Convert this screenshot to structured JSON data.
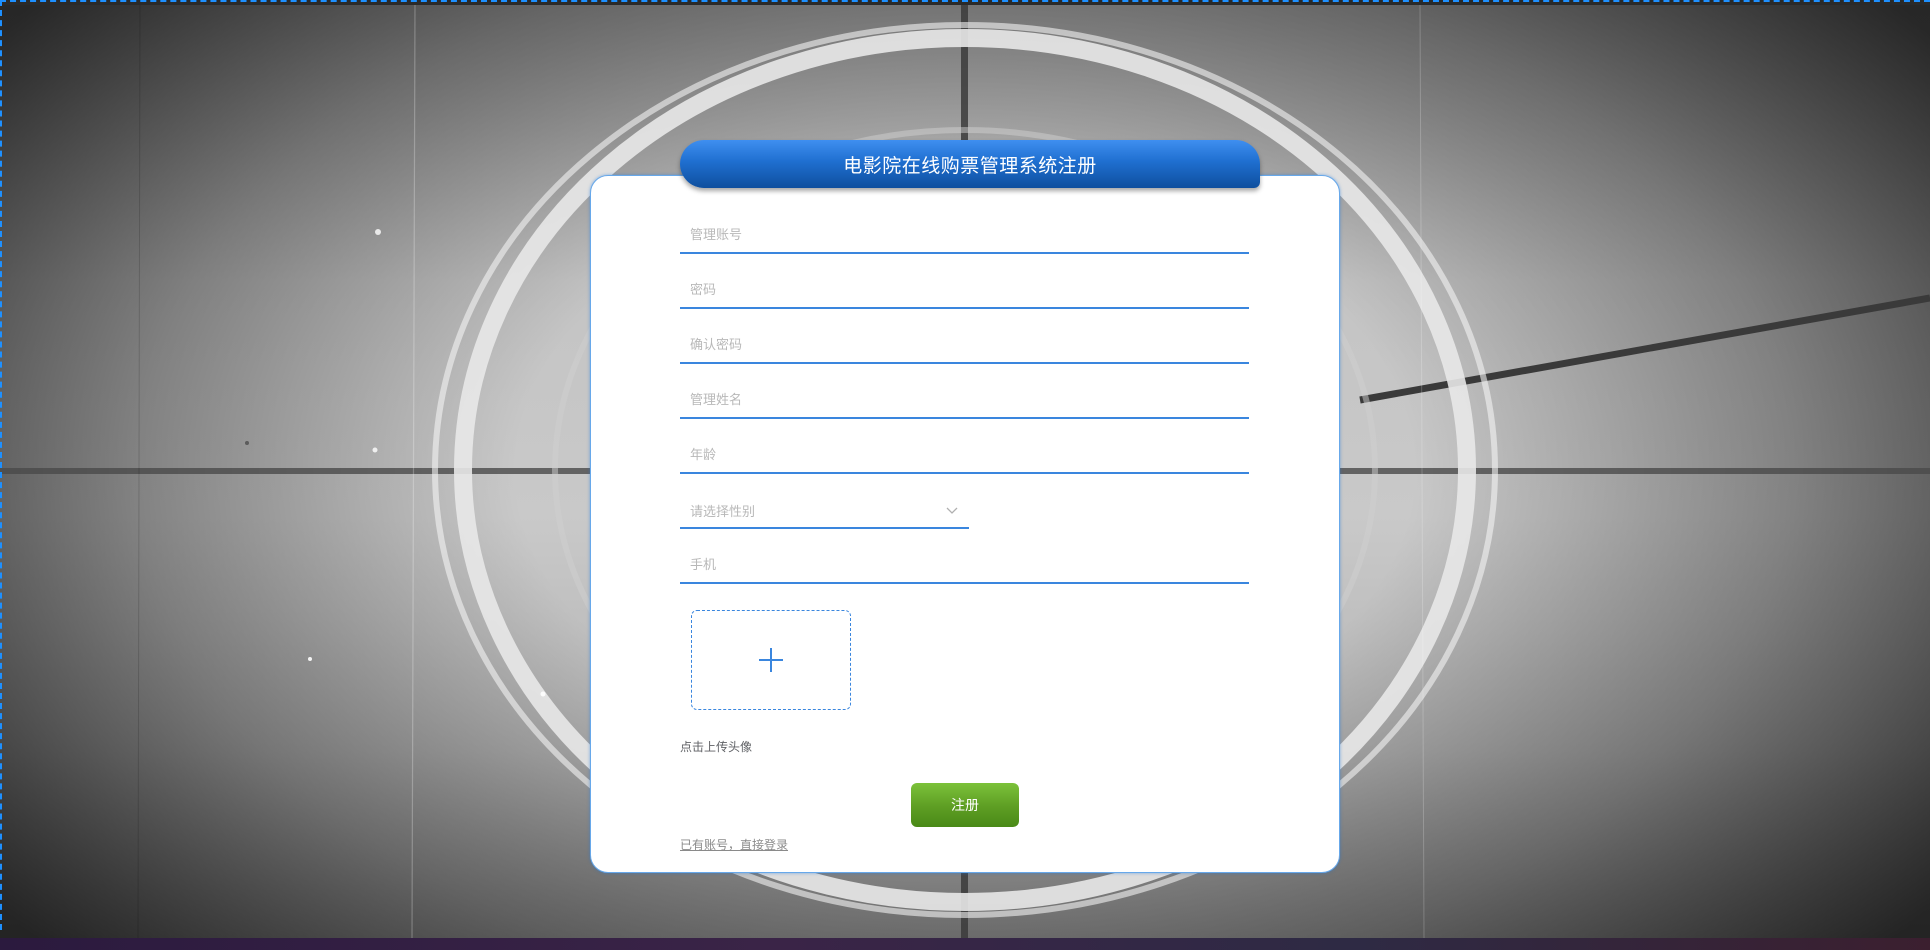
{
  "page": {
    "title": "电影院在线购票管理系统注册"
  },
  "form": {
    "account_placeholder": "管理账号",
    "password_placeholder": "密码",
    "confirm_password_placeholder": "确认密码",
    "name_placeholder": "管理姓名",
    "age_placeholder": "年龄",
    "gender_placeholder": "请选择性别",
    "phone_placeholder": "手机",
    "upload_icon": "plus-icon",
    "upload_label": "点击上传头像",
    "register_label": "注册",
    "login_link": "已有账号，直接登录"
  },
  "colors": {
    "accent": "#3a86de",
    "title_bar": "#1f6fd0",
    "register_button": "#5d9d23",
    "card_background": "#ffffff"
  }
}
